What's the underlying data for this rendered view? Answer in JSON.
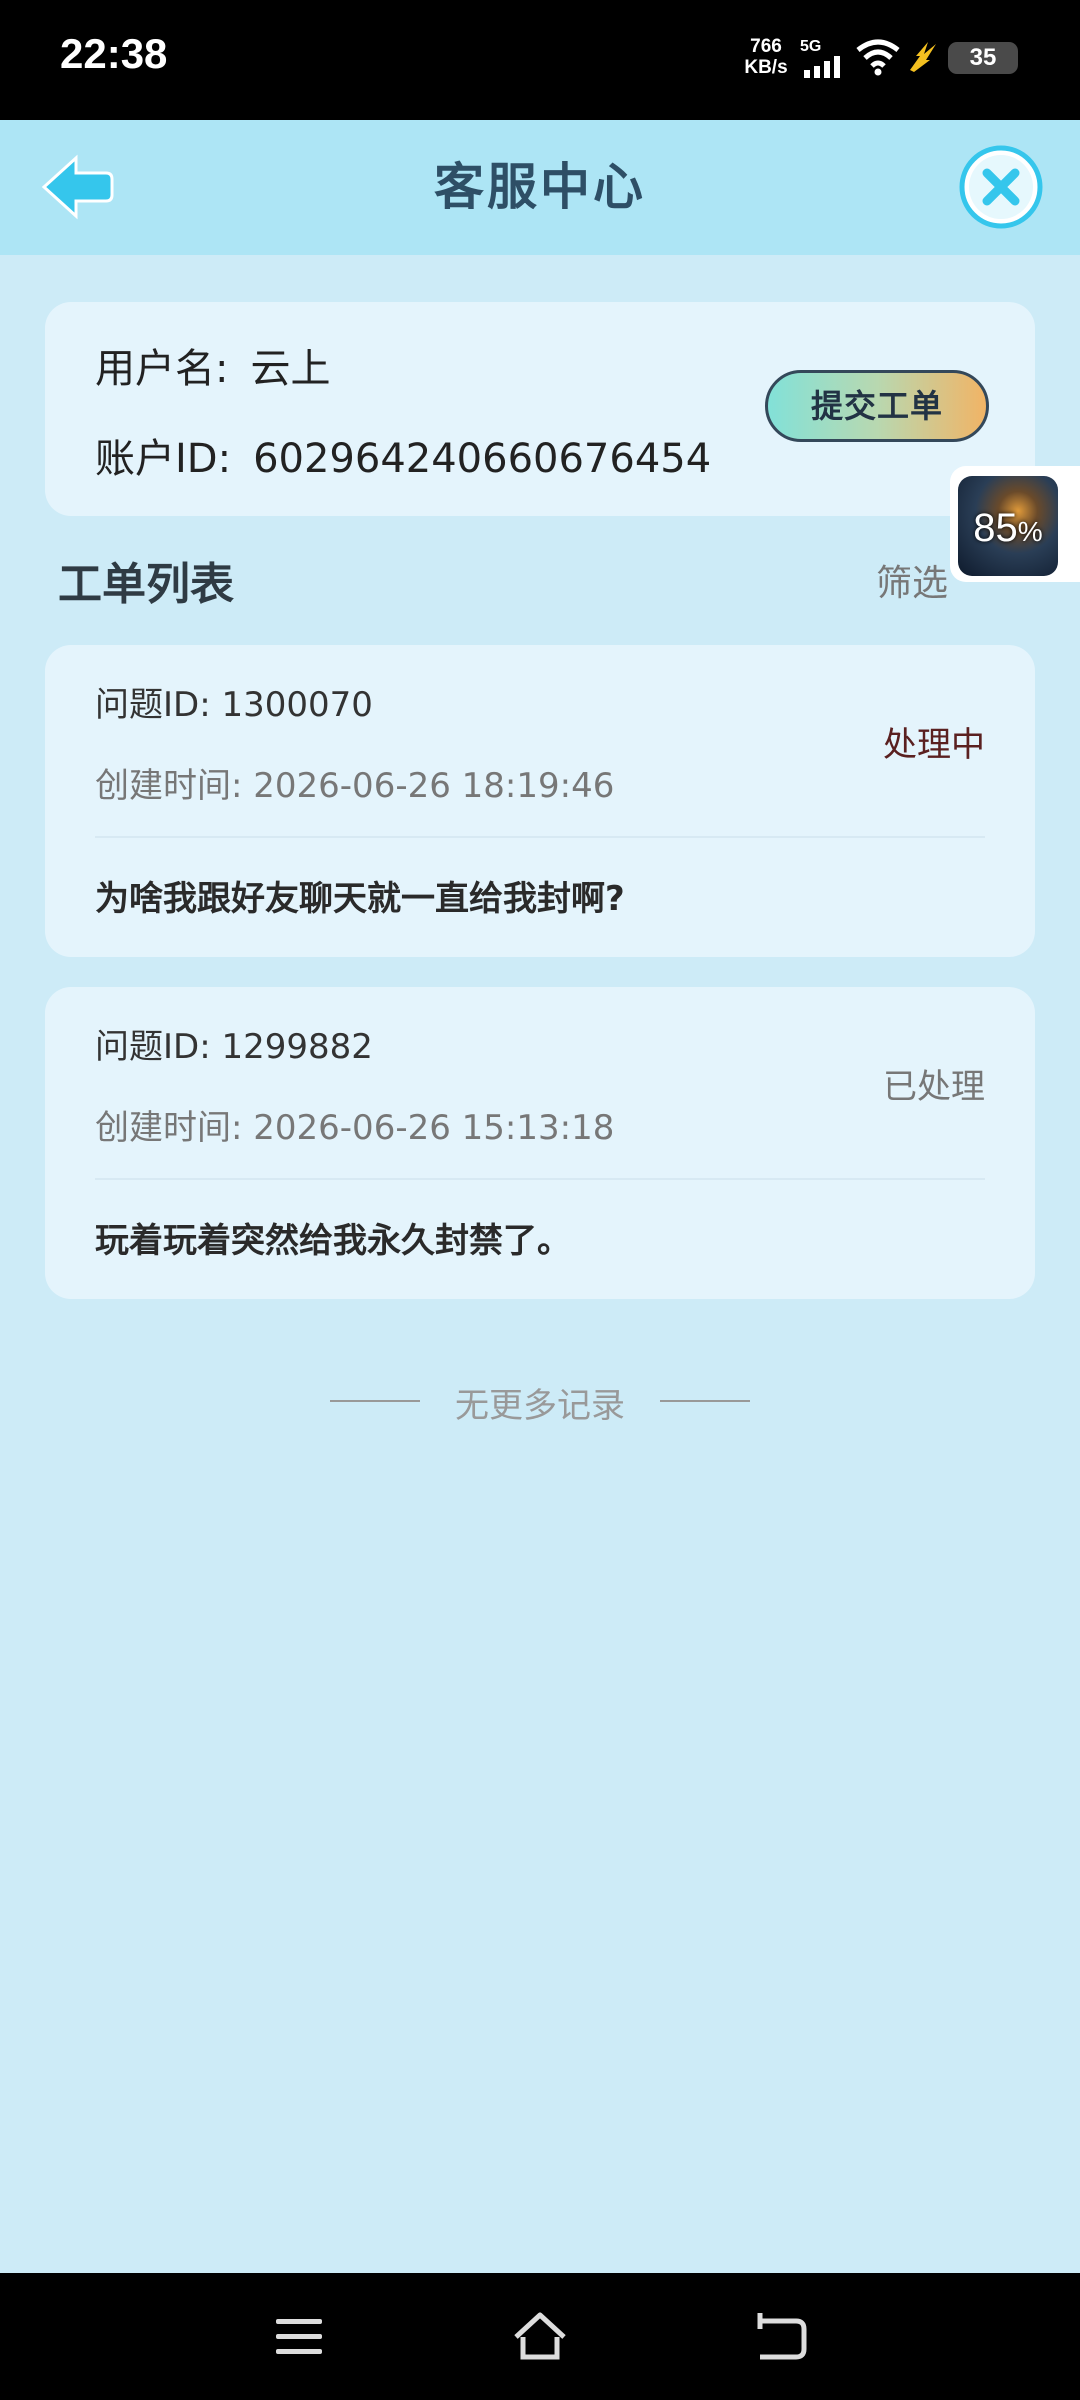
{
  "status_bar": {
    "time": "22:38",
    "net_speed_value": "766",
    "net_speed_unit": "KB/s",
    "network_type": "5G",
    "battery_level": "35"
  },
  "header": {
    "title": "客服中心",
    "back_icon": "arrow-left-icon",
    "close_icon": "close-x-icon"
  },
  "user_info": {
    "username_label": "用户名:",
    "username": "云上",
    "account_id_label": "账户ID:",
    "account_id": "602964240660676454",
    "submit_button": "提交工单"
  },
  "floating_widget": {
    "percent": "85",
    "percent_sign": "%"
  },
  "ticket_list": {
    "title": "工单列表",
    "filter_label": "筛选",
    "tickets": [
      {
        "id_label": "问题ID: 1300070",
        "created_label": "创建时间: 2026-06-26 18:19:46",
        "status": "处理中",
        "description": "为啥我跟好友聊天就一直给我封啊?"
      },
      {
        "id_label": "问题ID: 1299882",
        "created_label": "创建时间: 2026-06-26 15:13:18",
        "status": "已处理",
        "description": "玩着玩着突然给我永久封禁了。"
      }
    ],
    "end_text": "无更多记录"
  },
  "colors": {
    "background": "#cdebf7",
    "header_bg": "#ade5f5",
    "card_bg": "#e4f4fc",
    "accent_blue": "#35c6ec",
    "status_processing": "#5a2020",
    "status_done": "#777777"
  },
  "nav_bar": {
    "icons": [
      "menu-icon",
      "home-icon",
      "back-icon"
    ]
  }
}
